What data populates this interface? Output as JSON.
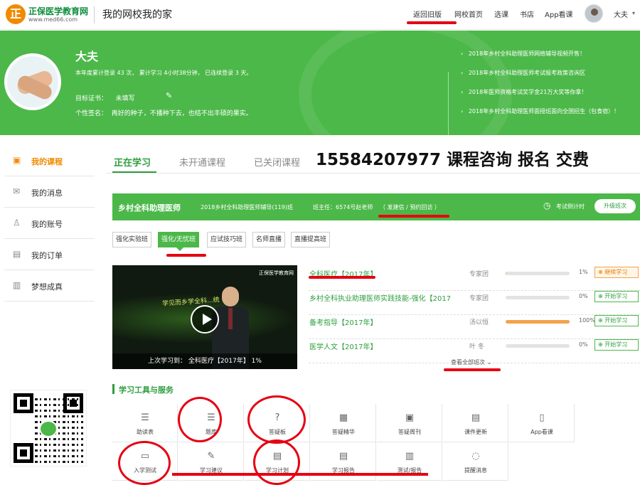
{
  "header": {
    "logo_name": "正保医学教育网",
    "logo_url": "www.med66.com",
    "site_title": "我的网校我的家",
    "nav": [
      "返回旧版",
      "网校首页",
      "选课",
      "书店",
      "App看课"
    ],
    "user_name": "大夫"
  },
  "profile": {
    "name": "大夫",
    "stats": "本年度累计登录 43 次，  累计学习 4小时38分钟，  已连续登录 3 天。",
    "cert_label": "目标证书：",
    "cert_value": "未填写",
    "motto_label": "个性签名：",
    "motto_value": "再好的种子，不播种下去，也结不出丰硕的果实。"
  },
  "news": [
    "2018年乡村全科助理医师网络辅导视频开售！",
    "2018年乡村全科助理医师考试报考政策咨询区",
    "2018年医师资格考试奖学金21万大奖等你拿！",
    "2018年乡村全科助理医师面授班面向全国招生（包食宿）！"
  ],
  "sidebar": {
    "items": [
      {
        "label": "我的课程",
        "icon": "monitor-icon"
      },
      {
        "label": "我的消息",
        "icon": "envelope-icon"
      },
      {
        "label": "我的账号",
        "icon": "user-icon"
      },
      {
        "label": "我的订单",
        "icon": "document-icon"
      },
      {
        "label": "梦想成真",
        "icon": "book-icon"
      }
    ]
  },
  "tabs": [
    "正在学习",
    "未开通课程",
    "已关闭课程"
  ],
  "overlay_text": "15584207977 课程咨询 报名 交费",
  "course": {
    "name": "乡村全科助理医师",
    "class": "2018乡村全科助理医师辅导(119)班",
    "teacher": "班主任：6574号赵老师",
    "links": "（ 发建信 / 预约回访 ）",
    "countdown": "考试倒计时",
    "upgrade": "升级班次"
  },
  "subtabs": [
    "强化实验班",
    "强化/无忧班",
    "应试技巧班",
    "名师直播",
    "直播提高班"
  ],
  "video": {
    "headline": "学见而乡学全科...统",
    "logo": "正保医学教育网",
    "last_study": "上次学习到：    全科医疗【2017年】    1%"
  },
  "rows": [
    {
      "title": "全科医疗【2017年】",
      "teacher": "专家团",
      "progress": 1,
      "pct": "1%",
      "button": "继续学习"
    },
    {
      "title": "乡村全科执业助理医师实践技能-强化【2017",
      "teacher": "专家团",
      "progress": 0,
      "pct": "0%",
      "button": "开始学习"
    },
    {
      "title": "备考指导【2017年】",
      "teacher": "汤以恒",
      "progress": 100,
      "pct": "100%",
      "button": "开始学习"
    },
    {
      "title": "医学人文【2017年】",
      "teacher": "叶  冬",
      "progress": 0,
      "pct": "0%",
      "button": "开始学习"
    }
  ],
  "view_all": "查看全部班次",
  "tools": {
    "title": "学习工具与服务",
    "items": [
      {
        "label": "题库",
        "icon": "list-icon"
      },
      {
        "label": "答疑板",
        "icon": "question-icon"
      },
      {
        "label": "答疑精华",
        "icon": "archive-icon"
      },
      {
        "label": "答疑周刊",
        "icon": "calendar-icon"
      },
      {
        "label": "课件更新",
        "icon": "document-icon"
      },
      {
        "label": "App看课",
        "icon": "phone-icon"
      },
      {
        "label": "入学测试",
        "icon": "monitor-check-icon"
      },
      {
        "label": "学习建议",
        "icon": "edit-icon"
      },
      {
        "label": "学习计划",
        "icon": "plan-icon"
      },
      {
        "label": "学习报告",
        "icon": "report-icon"
      },
      {
        "label": "测试/报告",
        "icon": "chart-icon"
      },
      {
        "label": "提醒消息",
        "icon": "chat-icon"
      }
    ],
    "first_label": "助读表"
  },
  "colors": {
    "green": "#4cb849",
    "accent": "#f08a00",
    "annotation": "#e60012"
  }
}
